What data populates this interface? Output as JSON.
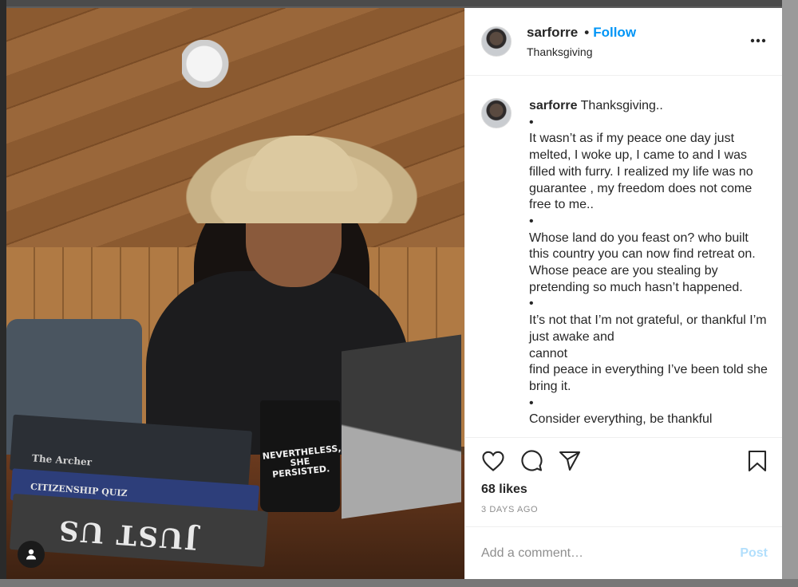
{
  "post": {
    "username": "sarforre",
    "dot": "•",
    "follow_label": "Follow",
    "location": "Thanksgiving",
    "more_icon": "more-horizontal-icon",
    "caption_username": "sarforre",
    "caption": " Thanksgiving..\n•\nIt wasn’t as if my peace one day just melted, I woke up, I came to and I was filled with furry. I realized my life was no guarantee , my freedom does not come free to me..\n•\nWhose land do you feast on? who built this country you can now find retreat on. Whose peace are you stealing by pretending so much hasn’t happened.\n•\nIt’s not that I’m not grateful, or thankful I’m just awake and\ncannot\nfind peace in everything I’ve been told she bring it.\n•\nConsider everything, be thankful",
    "likes": "68 likes",
    "time_ago": "3 DAYS AGO"
  },
  "photo": {
    "mug_text": "NEVERTHELESS, SHE PERSISTED.",
    "book1_text": "The Archer",
    "book2_text": "CITIZENSHIP QUIZ",
    "book3_text": "JUST US"
  },
  "comment": {
    "placeholder": "Add a comment…",
    "post_label": "Post"
  },
  "colors": {
    "follow": "#0095f6",
    "post_disabled": "#b2dffc",
    "muted": "#8e8e8e",
    "text": "#262626"
  }
}
